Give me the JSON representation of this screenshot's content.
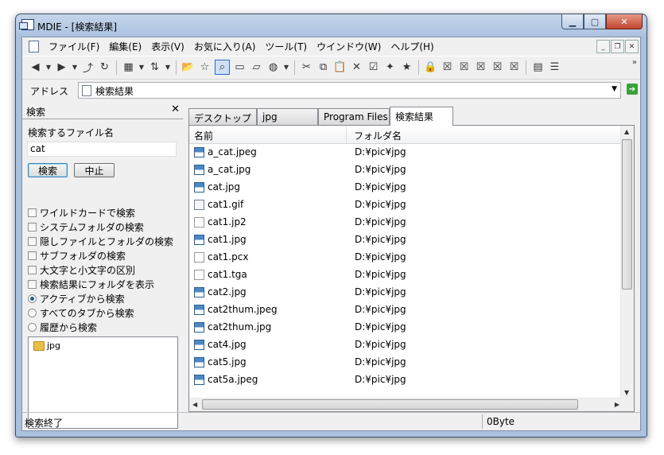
{
  "window": {
    "title": "MDIE - [検索結果]"
  },
  "menu": [
    "ファイル(F)",
    "編集(E)",
    "表示(V)",
    "お気に入り(A)",
    "ツール(T)",
    "ウインドウ(W)",
    "ヘルプ(H)"
  ],
  "address": {
    "label": "アドレス",
    "value": "検索結果"
  },
  "search_panel": {
    "title": "検索",
    "filename_label": "検索するファイル名",
    "filename_value": "cat",
    "search_button": "検索",
    "stop_button": "中止",
    "checkboxes": [
      "ワイルドカードで検索",
      "システムフォルダの検索",
      "隠しファイルとフォルダの検索",
      "サブフォルダの検索",
      "大文字と小文字の区別",
      "検索結果にフォルダを表示"
    ],
    "radios": [
      {
        "label": "アクティブから検索",
        "selected": true
      },
      {
        "label": "すべてのタブから検索",
        "selected": false
      },
      {
        "label": "履歴から検索",
        "selected": false
      }
    ],
    "tree_item": "jpg"
  },
  "tabs": [
    "デスクトップ",
    "jpg",
    "Program Files",
    "検索結果"
  ],
  "active_tab": "検索結果",
  "columns": {
    "name": "名前",
    "folder": "フォルダ名"
  },
  "files": [
    {
      "name": "a_cat.jpeg",
      "folder": "D:¥pic¥jpg",
      "icon": "image-icon"
    },
    {
      "name": "a_cat.jpg",
      "folder": "D:¥pic¥jpg",
      "icon": "image-icon"
    },
    {
      "name": "cat.jpg",
      "folder": "D:¥pic¥jpg",
      "icon": "image-icon"
    },
    {
      "name": "cat1.gif",
      "folder": "D:¥pic¥jpg",
      "icon": "gif-icon"
    },
    {
      "name": "cat1.jp2",
      "folder": "D:¥pic¥jpg",
      "icon": "document-icon"
    },
    {
      "name": "cat1.jpg",
      "folder": "D:¥pic¥jpg",
      "icon": "image-icon"
    },
    {
      "name": "cat1.pcx",
      "folder": "D:¥pic¥jpg",
      "icon": "document-icon"
    },
    {
      "name": "cat1.tga",
      "folder": "D:¥pic¥jpg",
      "icon": "document-icon"
    },
    {
      "name": "cat2.jpg",
      "folder": "D:¥pic¥jpg",
      "icon": "image-icon"
    },
    {
      "name": "cat2thum.jpeg",
      "folder": "D:¥pic¥jpg",
      "icon": "image-icon"
    },
    {
      "name": "cat2thum.jpg",
      "folder": "D:¥pic¥jpg",
      "icon": "image-icon"
    },
    {
      "name": "cat4.jpg",
      "folder": "D:¥pic¥jpg",
      "icon": "image-icon"
    },
    {
      "name": "cat5.jpg",
      "folder": "D:¥pic¥jpg",
      "icon": "image-icon"
    },
    {
      "name": "cat5a.jpeg",
      "folder": "D:¥pic¥jpg",
      "icon": "image-icon"
    }
  ],
  "status": {
    "left": "検索終了",
    "right": "0Byte"
  }
}
